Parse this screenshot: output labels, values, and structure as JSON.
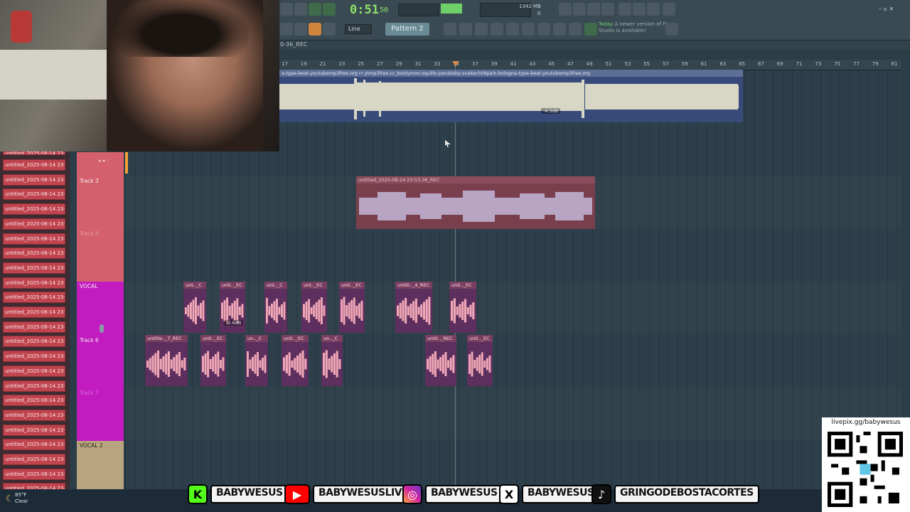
{
  "toolbar": {
    "time": "0:51",
    "time_frac": "50",
    "cpu": "1342 MB",
    "cpu_voices": "0",
    "snap": "Line",
    "pattern": "Pattern 2",
    "news_prefix": "Today",
    "news_text": "A newer version of FL Studio is available!"
  },
  "playlist": {
    "title": "0-36_REC",
    "ruler_ticks": [
      "17",
      "19",
      "21",
      "23",
      "25",
      "27",
      "29",
      "31",
      "33",
      "35",
      "37",
      "39",
      "41",
      "43",
      "45",
      "47",
      "49",
      "51",
      "53",
      "55",
      "57",
      "59",
      "61",
      "63",
      "65",
      "67",
      "69",
      "71",
      "73",
      "75",
      "77",
      "79",
      "81"
    ]
  },
  "clips": {
    "beat_title": "a-type-beat-youtubemp3free.org  ↦ ytmp3free.cc_boolymon-squillo-perubaby-snakechildpain-bologna-type-beat-youtubemp3free.org",
    "beat_gain": "-4.5dB",
    "rec_title": "untitled_2025-08-14 23-53-36_REC",
    "vocal_row1": [
      "unt.._C",
      "unti.._EC",
      "unt.._C",
      "unt.._EC",
      "unti.._EC",
      "untitl.._4_REC",
      "unti.._EC"
    ],
    "vocal_row1_gain": "-2.6dB",
    "vocal_row2": [
      "untitle.._7_REC",
      "unti.._EC",
      "un.._C",
      "unti.._EC",
      "un.._C",
      "untit.._REC",
      "unti.._EC"
    ]
  },
  "tracks": {
    "track3": "Track 3",
    "track4": "Track 4",
    "vocal": "VOCAL",
    "track6": "Track 6",
    "track7": "Track 7",
    "vocal2": "VOCAL 2"
  },
  "channel_list": {
    "first": "untitled_2025-08-14 23-",
    "items": [
      "untitled_2025-08-14 23-",
      "untitled_2025-08-14 23-",
      "untitled_2025-08-14 23-",
      "untitled_2025-08-14 23-",
      "untitled_2025-08-14 23-",
      "untitled_2025-08-14 23-",
      "untitled_2025-08-14 23-",
      "untitled_2025-08-14 23-",
      "untitled_2025-08-14 23-",
      "untitled_2025-08-14 23-",
      "untitled_2025-08-14 23-",
      "untitled_2025-08-14 23-",
      "untitled_2025-08-14 23-",
      "untitled_2025-08-14 23-",
      "untitled_2025-08-14 23-",
      "untitled_2025-08-14 23-",
      "untitled_2025-08-14 23-",
      "untitled_2025-08-14 23-",
      "untitled_2025-08-14 23-",
      "untitled_2025-08-14 23-",
      "untitled_2025-08-14 23-",
      "untitled_2025-08-14 23-",
      "untitled_2025-08-14 23-"
    ]
  },
  "social": {
    "kick": "BABYWESUS",
    "youtube": "BABYWESUSLIVE",
    "instagram": "BABYWESUS",
    "x": "BABYWESUS",
    "tiktok": "GRINGODEBOSTACORTES"
  },
  "weather": {
    "temp": "85°F",
    "cond": "Clear"
  },
  "qr": {
    "label": "livepix.gg/babywesus"
  },
  "colors": {
    "accent_green": "#8fe06a",
    "vocal_track": "#c21bc0",
    "rec_track": "#d9606d",
    "beat_track": "#3a4a85",
    "kick": "#53fc18",
    "youtube": "#ff0000",
    "instagram": "#d6249f"
  }
}
